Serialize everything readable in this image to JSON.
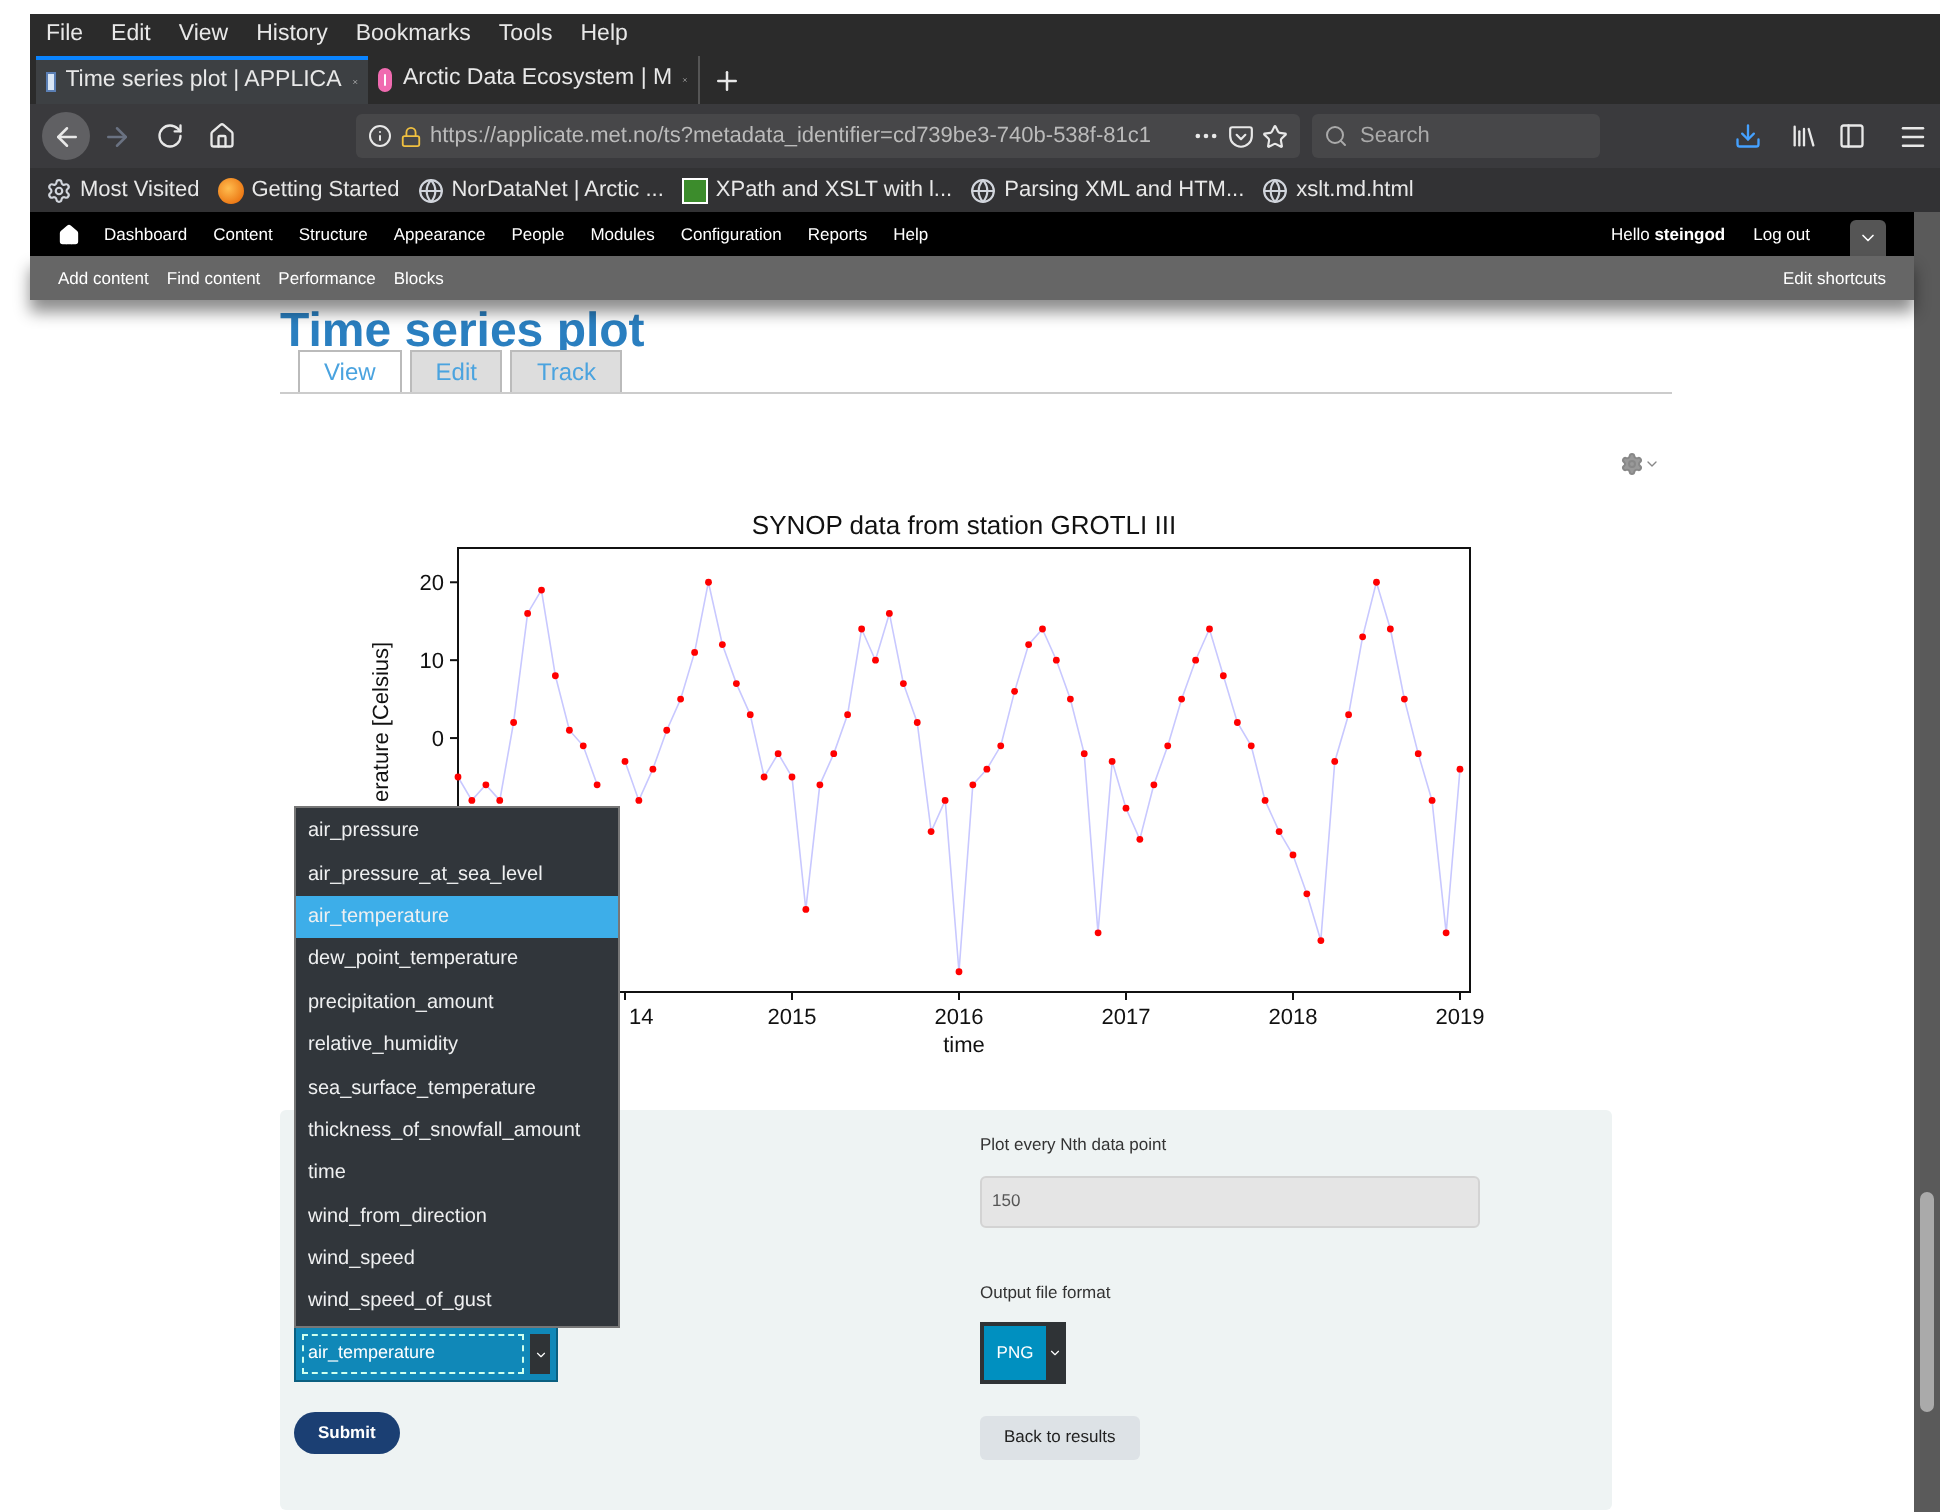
{
  "browser": {
    "menu": [
      "File",
      "Edit",
      "View",
      "History",
      "Bookmarks",
      "Tools",
      "Help"
    ],
    "tabs": [
      {
        "title": "Time series plot | APPLICA",
        "selected": true
      },
      {
        "title": "Arctic Data Ecosystem | M",
        "selected": false
      }
    ],
    "url": "https://applicate.met.no/ts?metadata_identifier=cd739be3-740b-538f-81c1",
    "search": {
      "placeholder": "Search"
    },
    "bookmarks": [
      {
        "label": "Most Visited",
        "kind": "gear"
      },
      {
        "label": "Getting Started",
        "kind": "firefox"
      },
      {
        "label": "NorDataNet | Arctic ...",
        "kind": "globe"
      },
      {
        "label": "XPath and XSLT with l...",
        "kind": "xslt"
      },
      {
        "label": "Parsing XML and HTM...",
        "kind": "globe"
      },
      {
        "label": "xslt.md.html",
        "kind": "globe"
      }
    ]
  },
  "admin_toolbar": {
    "items": [
      "Dashboard",
      "Content",
      "Structure",
      "Appearance",
      "People",
      "Modules",
      "Configuration",
      "Reports",
      "Help"
    ],
    "greeting": "Hello **steingod**",
    "logout": "Log out"
  },
  "shortcuts": {
    "items": [
      "Add content",
      "Find content",
      "Performance",
      "Blocks"
    ],
    "edit": "Edit shortcuts"
  },
  "page": {
    "title": "Time series plot",
    "tabs": [
      {
        "label": "View",
        "selected": true
      },
      {
        "label": "Edit",
        "selected": false
      },
      {
        "label": "Track",
        "selected": false
      }
    ]
  },
  "chart_data": {
    "type": "line",
    "title": "SYNOP data from station GROTLI III",
    "xlabel": "time",
    "ylabel": "erature [Celsius]",
    "x": [
      2013.0,
      2013.083,
      2013.167,
      2013.25,
      2013.333,
      2013.417,
      2013.5,
      2013.583,
      2013.667,
      2013.75,
      2013.833,
      2013.917,
      2014.0,
      2014.083,
      2014.167,
      2014.25,
      2014.333,
      2014.417,
      2014.5,
      2014.583,
      2014.667,
      2014.75,
      2014.833,
      2014.917,
      2015.0,
      2015.083,
      2015.167,
      2015.25,
      2015.333,
      2015.417,
      2015.5,
      2015.583,
      2015.667,
      2015.75,
      2015.833,
      2015.917,
      2016.0,
      2016.083,
      2016.167,
      2016.25,
      2016.333,
      2016.417,
      2016.5,
      2016.583,
      2016.667,
      2016.75,
      2016.833,
      2016.917,
      2017.0,
      2017.083,
      2017.167,
      2017.25,
      2017.333,
      2017.417,
      2017.5,
      2017.583,
      2017.667,
      2017.75,
      2017.833,
      2017.917,
      2018.0,
      2018.083,
      2018.167,
      2018.25,
      2018.333,
      2018.417,
      2018.5,
      2018.583,
      2018.667,
      2018.75,
      2018.833,
      2018.917,
      2019.0
    ],
    "series": [
      {
        "color": "#ff0000",
        "marker": "o",
        "values": [
          -5,
          -8,
          -6,
          -8,
          2,
          16,
          19,
          8,
          1,
          -1,
          -6,
          null,
          -3,
          -8,
          -4,
          1,
          5,
          11,
          20,
          12,
          7,
          3,
          -5,
          -2,
          -5,
          -22,
          -6,
          -2,
          3,
          14,
          10,
          16,
          7,
          2,
          -12,
          -8,
          -30,
          -6,
          -4,
          -1,
          6,
          12,
          14,
          10,
          5,
          -2,
          -25,
          -3,
          -9,
          -13,
          -6,
          -1,
          5,
          10,
          14,
          8,
          2,
          -1,
          -8,
          -12,
          -15,
          -20,
          -26,
          -3,
          3,
          13,
          20,
          14,
          5,
          -2,
          -8,
          -25,
          -4
        ]
      }
    ],
    "xlim": [
      2013.0,
      2019.06
    ],
    "ylim": [
      -32.6,
      24.4
    ],
    "xticks": [
      {
        "value": 2014,
        "label": "14"
      },
      2015,
      2016,
      2017,
      2018,
      2019
    ],
    "yticks": [
      0,
      10,
      20
    ]
  },
  "form": {
    "variable_options": [
      {
        "label": "air_pressure",
        "selected": false
      },
      {
        "label": "air_pressure_at_sea_level",
        "selected": false
      },
      {
        "label": "air_temperature",
        "selected": true
      },
      {
        "label": "dew_point_temperature",
        "selected": false
      },
      {
        "label": "precipitation_amount",
        "selected": false
      },
      {
        "label": "relative_humidity",
        "selected": false
      },
      {
        "label": "sea_surface_temperature",
        "selected": false
      },
      {
        "label": "thickness_of_snowfall_amount",
        "selected": false
      },
      {
        "label": "time",
        "selected": false
      },
      {
        "label": "wind_from_direction",
        "selected": false
      },
      {
        "label": "wind_speed",
        "selected": false
      },
      {
        "label": "wind_speed_of_gust",
        "selected": false
      }
    ],
    "variable_value": "air_temperature",
    "submit": "Submit",
    "nth_label": "Plot every Nth data point",
    "nth_value": "150",
    "format_label": "Output file format",
    "format_value": "PNG",
    "back": "Back to results"
  }
}
